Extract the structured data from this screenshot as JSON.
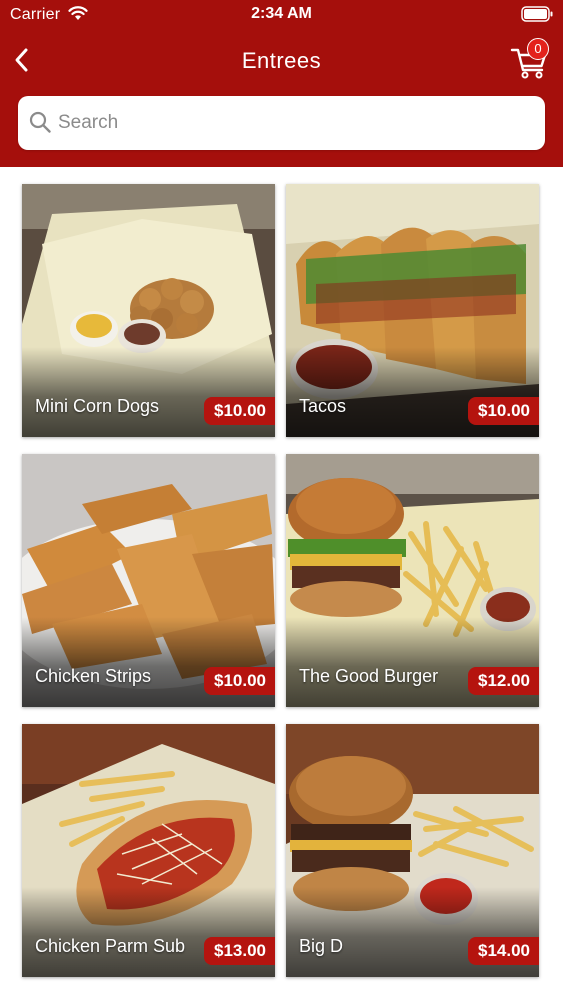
{
  "status_bar": {
    "carrier": "Carrier",
    "time": "2:34 AM"
  },
  "nav": {
    "title": "Entrees",
    "back_icon": "chevron-left-icon",
    "cart_icon": "cart-icon",
    "cart_count": "0"
  },
  "search": {
    "placeholder": "Search",
    "value": ""
  },
  "colors": {
    "brand_red": "#a50f0c",
    "price_badge": "#b5140f",
    "cart_badge": "#e3221c"
  },
  "items": [
    {
      "name": "Mini Corn Dogs",
      "price": "$10.00"
    },
    {
      "name": "Tacos",
      "price": "$10.00"
    },
    {
      "name": "Chicken Strips",
      "price": "$10.00"
    },
    {
      "name": "The Good Burger",
      "price": "$12.00"
    },
    {
      "name": "Chicken Parm Sub",
      "price": "$13.00"
    },
    {
      "name": "Big D",
      "price": "$14.00"
    }
  ]
}
